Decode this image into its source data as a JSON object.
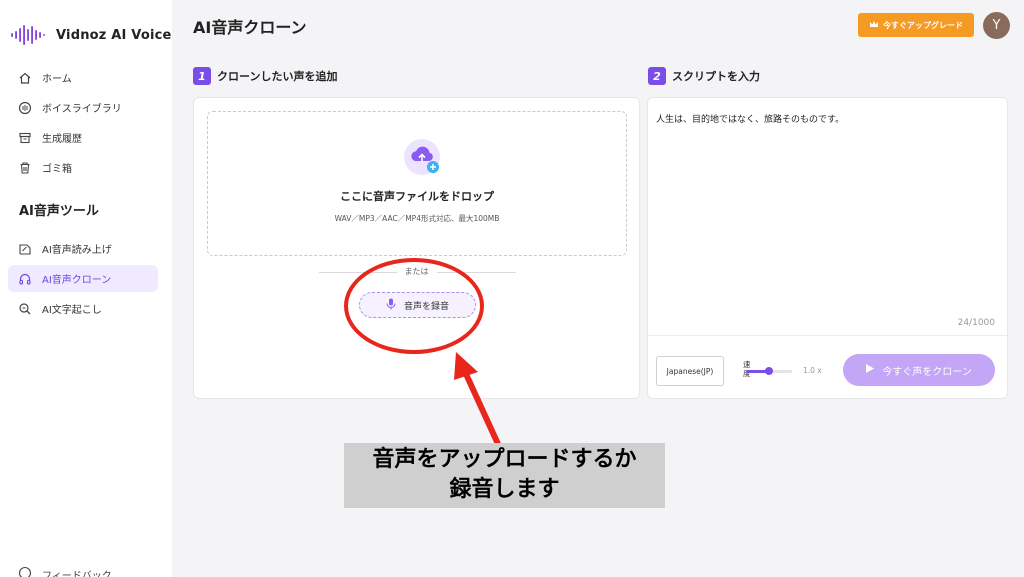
{
  "app": {
    "name": "Vidnoz AI Voice"
  },
  "sidebar": {
    "items": [
      {
        "label": "ホーム",
        "icon": "home-icon"
      },
      {
        "label": "ボイスライブラリ",
        "icon": "voice-library-icon"
      },
      {
        "label": "生成履歴",
        "icon": "history-icon"
      },
      {
        "label": "ゴミ箱",
        "icon": "trash-icon"
      }
    ],
    "section_title": "AI音声ツール",
    "tools": [
      {
        "label": "AI音声読み上げ",
        "icon": "tts-icon"
      },
      {
        "label": "AI音声クローン",
        "icon": "headphones-icon",
        "active": true
      },
      {
        "label": "AI文字起こし",
        "icon": "transcribe-icon"
      }
    ],
    "feedback_label": "フィードバック"
  },
  "header": {
    "title": "AI音声クローン",
    "upgrade_label": "今すぐアップグレード",
    "avatar_initial": "Y"
  },
  "step1": {
    "number": "1",
    "title": "クローンしたい声を追加",
    "drop_title": "ここに音声ファイルをドロップ",
    "drop_subtitle": "WAV／MP3／AAC／MP4形式対応、最大100MB",
    "or_text": "または",
    "record_label": "音声を録音"
  },
  "step2": {
    "number": "2",
    "title": "スクリプトを入力",
    "script_text": "人生は、目的地ではなく、旅路そのものです。",
    "char_count": "24/1000",
    "language": "Japanese(JP)",
    "speed_label": "速度",
    "speed_value": "1.0 x",
    "speed_fraction": 0.5,
    "clone_label": "今すぐ声をクローン"
  },
  "annotation": {
    "line1": "音声をアップロードするか",
    "line2": "録音します"
  },
  "colors": {
    "accent": "#7b4de8",
    "upgrade": "#f59a23",
    "annotation_red": "#e8261c"
  }
}
